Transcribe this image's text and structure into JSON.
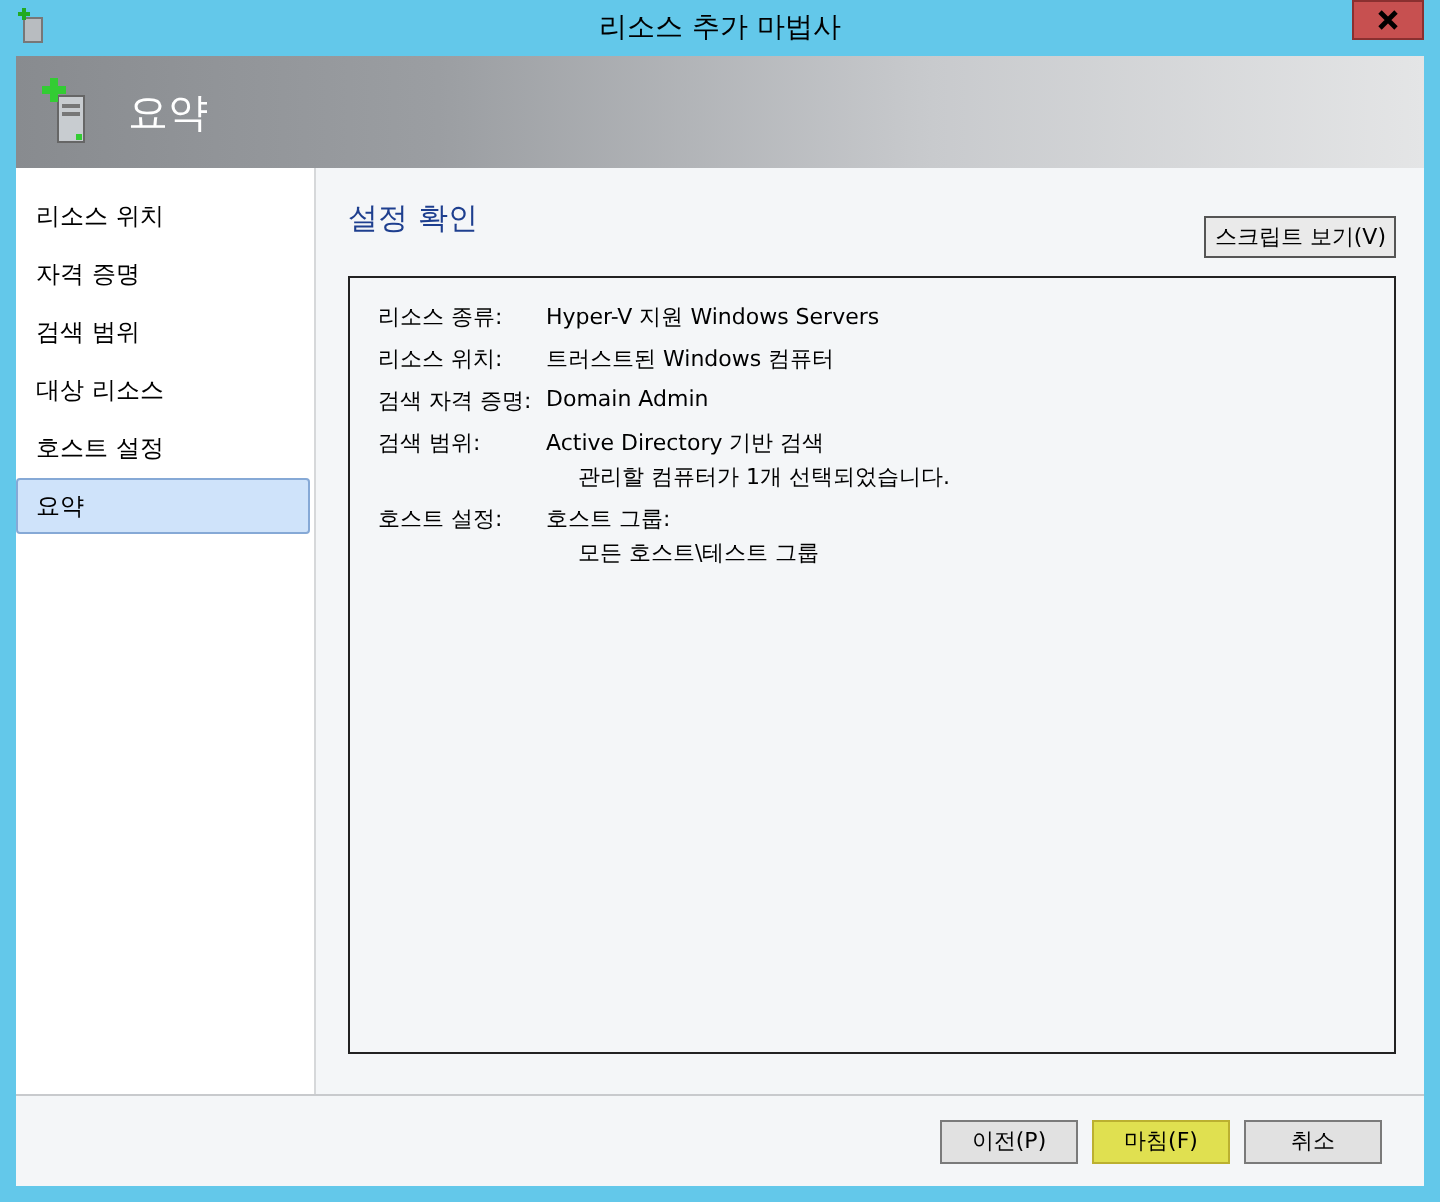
{
  "window": {
    "title": "리소스 추가 마법사"
  },
  "header": {
    "title": "요약"
  },
  "sidebar": {
    "items": [
      {
        "label": "리소스 위치",
        "selected": false
      },
      {
        "label": "자격 증명",
        "selected": false
      },
      {
        "label": "검색 범위",
        "selected": false
      },
      {
        "label": "대상 리소스",
        "selected": false
      },
      {
        "label": "호스트 설정",
        "selected": false
      },
      {
        "label": "요약",
        "selected": true
      }
    ]
  },
  "content": {
    "title": "설정 확인",
    "script_button": "스크립트 보기(V)",
    "summary": [
      {
        "label": "리소스 종류:",
        "lines": [
          "Hyper-V 지원 Windows Servers"
        ]
      },
      {
        "label": "리소스 위치:",
        "lines": [
          "트러스트된 Windows 컴퓨터"
        ]
      },
      {
        "label": "검색 자격 증명:",
        "lines": [
          "Domain Admin"
        ]
      },
      {
        "label": "검색 범위:",
        "lines": [
          "Active Directory 기반 검색",
          "관리할 컴퓨터가 1개 선택되었습니다."
        ]
      },
      {
        "label": "호스트 설정:",
        "lines": [
          "호스트 그룹:",
          "모든 호스트\\테스트 그룹"
        ]
      }
    ]
  },
  "buttons": [
    {
      "label": "이전(P)",
      "highlighted": false
    },
    {
      "label": "마침(F)",
      "highlighted": true
    },
    {
      "label": "취소",
      "highlighted": false
    }
  ]
}
